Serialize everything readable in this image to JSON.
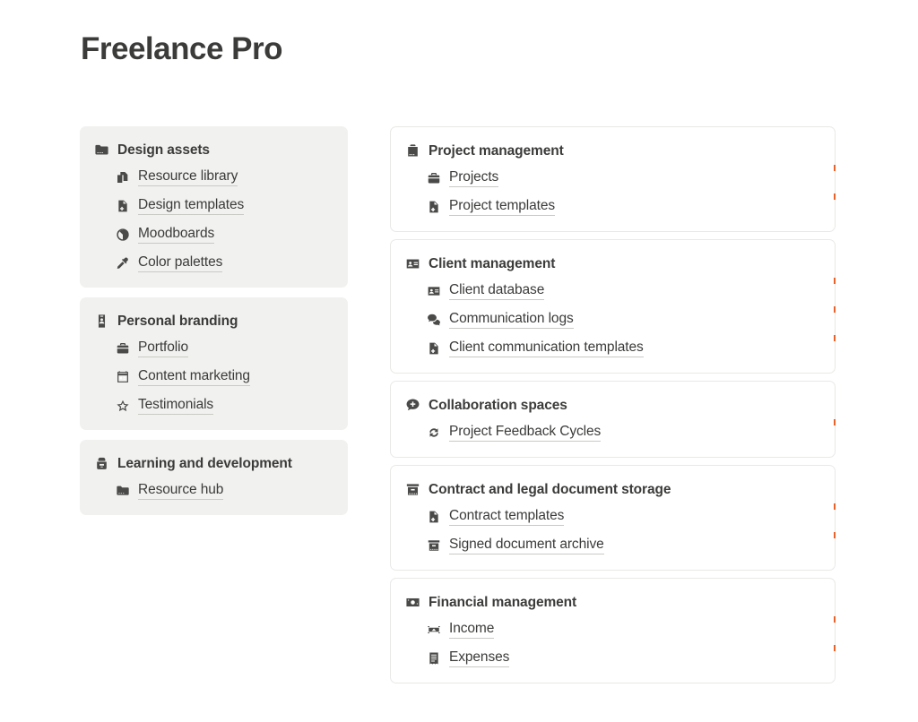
{
  "page": {
    "title": "Freelance Pro",
    "accent_color": "#e8622a",
    "text_color": "#3b3b3a",
    "card_gray_bg": "#f1f1ef",
    "card_border": "#e9e9e7"
  },
  "left_column": [
    {
      "header": {
        "label": "Design assets",
        "icon": "folder-icon"
      },
      "children": [
        {
          "label": "Resource library",
          "icon": "copy-documents-icon"
        },
        {
          "label": "Design templates",
          "icon": "file-plus-icon"
        },
        {
          "label": "Moodboards",
          "icon": "contrast-circle-icon"
        },
        {
          "label": "Color palettes",
          "icon": "eyedropper-icon"
        }
      ]
    },
    {
      "header": {
        "label": "Personal branding",
        "icon": "id-badge-icon"
      },
      "children": [
        {
          "label": "Portfolio",
          "icon": "briefcase-icon"
        },
        {
          "label": "Content marketing",
          "icon": "calendar-icon"
        },
        {
          "label": "Testimonials",
          "icon": "star-icon"
        }
      ]
    },
    {
      "header": {
        "label": "Learning and development",
        "icon": "backpack-icon"
      },
      "children": [
        {
          "label": "Resource hub",
          "icon": "folder-icon"
        }
      ]
    }
  ],
  "right_column": [
    {
      "header": {
        "label": "Project management",
        "icon": "clipboard-icon"
      },
      "children": [
        {
          "label": "Projects",
          "icon": "briefcase-icon"
        },
        {
          "label": "Project templates",
          "icon": "file-plus-icon"
        }
      ]
    },
    {
      "header": {
        "label": "Client management",
        "icon": "contact-card-icon"
      },
      "children": [
        {
          "label": "Client database",
          "icon": "contact-card-icon"
        },
        {
          "label": "Communication logs",
          "icon": "chat-bubbles-icon"
        },
        {
          "label": "Client communication templates",
          "icon": "file-plus-icon"
        }
      ]
    },
    {
      "header": {
        "label": "Collaboration spaces",
        "icon": "chat-plus-icon"
      },
      "children": [
        {
          "label": "Project Feedback Cycles",
          "icon": "refresh-cycle-icon"
        }
      ]
    },
    {
      "header": {
        "label": "Contract and legal document storage",
        "icon": "archive-box-icon"
      },
      "children": [
        {
          "label": "Contract templates",
          "icon": "file-plus-icon"
        },
        {
          "label": "Signed document archive",
          "icon": "archive-box-icon"
        }
      ]
    },
    {
      "header": {
        "label": "Financial management",
        "icon": "banknote-icon"
      },
      "children": [
        {
          "label": "Income",
          "icon": "money-bill-icon"
        },
        {
          "label": "Expenses",
          "icon": "receipt-icon"
        }
      ]
    }
  ]
}
